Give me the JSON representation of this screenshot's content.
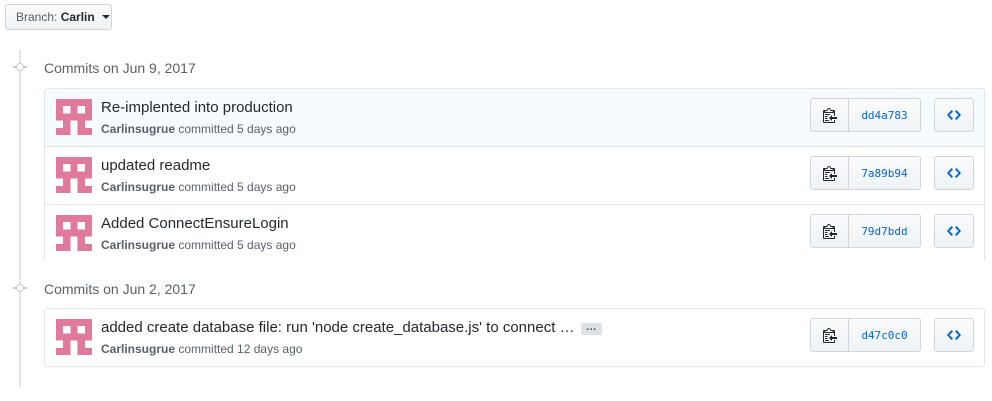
{
  "branch": {
    "label": "Branch:",
    "value": "Carlin"
  },
  "groups": [
    {
      "title": "Commits on Jun 9, 2017",
      "commits": [
        {
          "title": "Re-implented into production",
          "author": "Carlinsugrue",
          "time": "committed 5 days ago",
          "sha": "dd4a783"
        },
        {
          "title": "updated readme",
          "author": "Carlinsugrue",
          "time": "committed 5 days ago",
          "sha": "7a89b94"
        },
        {
          "title": "Added ConnectEnsureLogin",
          "author": "Carlinsugrue",
          "time": "committed 5 days ago",
          "sha": "79d7bdd"
        }
      ]
    },
    {
      "title": "Commits on Jun 2, 2017",
      "commits": [
        {
          "title": "added create database file: run 'node create_database.js' to connect …",
          "author": "Carlinsugrue",
          "time": "committed 12 days ago",
          "sha": "d47c0c0",
          "more": "…"
        }
      ]
    }
  ],
  "icons": {
    "copy": "clippy-icon",
    "browse": "code-icon",
    "avatar": "identicon-avatar",
    "caret": "caret-down-icon"
  },
  "colors": {
    "avatar": "#e07a9b",
    "link": "#0366d6",
    "highlight_row": "#f6fbff"
  }
}
